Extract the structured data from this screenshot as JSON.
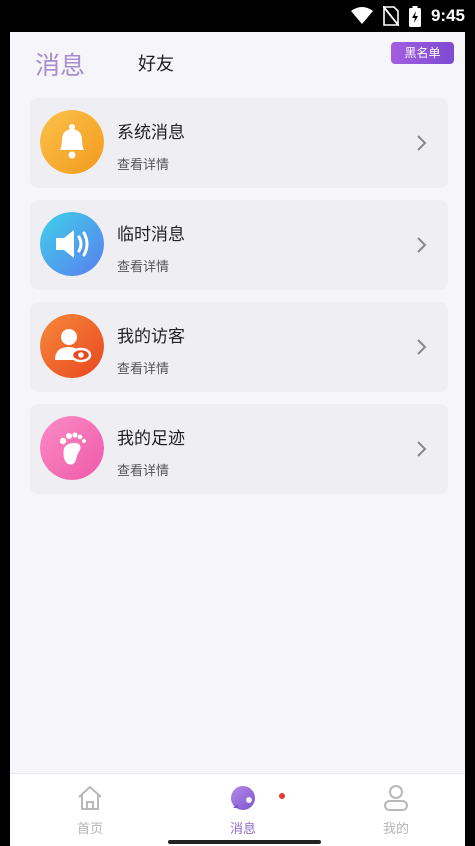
{
  "status_bar": {
    "time": "9:45",
    "icons": [
      "wifi-icon",
      "no-sim-icon",
      "battery-charging-icon"
    ]
  },
  "header": {
    "tabs": [
      {
        "label": "消息",
        "active": true
      },
      {
        "label": "好友",
        "active": false
      }
    ],
    "blacklist_label": "黑名单"
  },
  "accent_color": "#a98bd0",
  "items": [
    {
      "title": "系统消息",
      "subtitle": "查看详情",
      "icon": "bell-icon",
      "color": "#f6a623"
    },
    {
      "title": "临时消息",
      "subtitle": "查看详情",
      "icon": "speaker-icon",
      "color": "#3aa3f0"
    },
    {
      "title": "我的访客",
      "subtitle": "查看详情",
      "icon": "visitor-icon",
      "color": "#f06a2a"
    },
    {
      "title": "我的足迹",
      "subtitle": "查看详情",
      "icon": "footprint-icon",
      "color": "#f56fb2"
    }
  ],
  "bottom_nav": [
    {
      "label": "首页",
      "icon": "home-icon",
      "active": false
    },
    {
      "label": "消息",
      "icon": "chat-bubble-icon",
      "active": true,
      "badge_dot": true
    },
    {
      "label": "我的",
      "icon": "user-icon",
      "active": false
    }
  ]
}
